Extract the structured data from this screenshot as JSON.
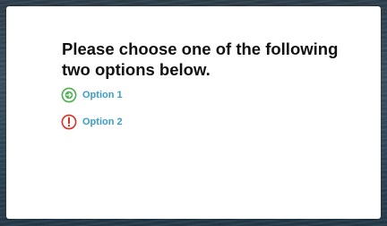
{
  "dialog": {
    "title": "Please choose one of the following two options below.",
    "options": [
      {
        "label": "Option 1",
        "icon": "arrow-right-circle-icon",
        "icon_color": "#4caf50"
      },
      {
        "label": "Option 2",
        "icon": "exclamation-circle-icon",
        "icon_color": "#d93025"
      }
    ],
    "link_color": "#3a9ec7"
  }
}
